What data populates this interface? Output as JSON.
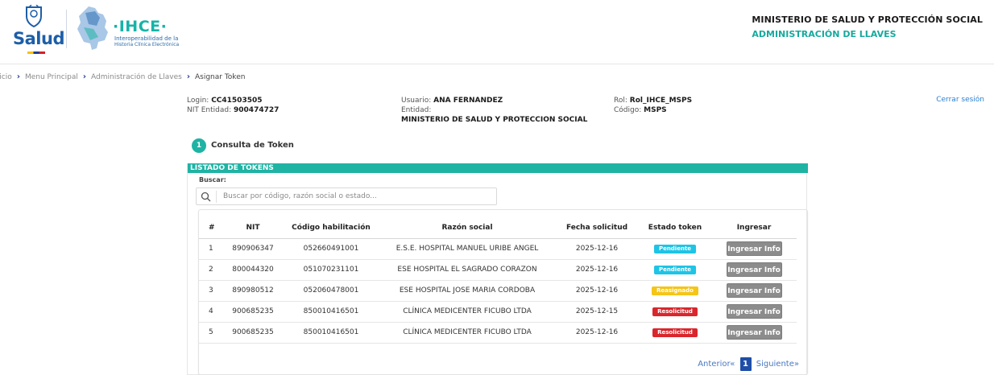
{
  "header": {
    "logo_salud": "Salud",
    "logo_ihce": "·IHCE·",
    "logo_ihce_sub1": "Interoperabilidad de la",
    "logo_ihce_sub2": "Historia Clínica Electrónica",
    "ministry_title": "MINISTERIO DE SALUD Y PROTECCIÓN SOCIAL",
    "ministry_subtitle": "ADMINISTRACIÓN DE LLAVES"
  },
  "breadcrumb": [
    "Inicio",
    "Menu Principal",
    "Administración de Llaves",
    "Asignar Token"
  ],
  "user_info": {
    "login_label": "Login:",
    "login_value": "CC41503505",
    "nit_label": "NIT Entidad:",
    "nit_value": "900474727",
    "usuario_label": "Usuario:",
    "usuario_value": "ANA FERNANDEZ",
    "entidad_label": "Entidad:",
    "entidad_value": "MINISTERIO DE SALUD Y PROTECCION SOCIAL",
    "rol_label": "Rol:",
    "rol_value": "Rol_IHCE_MSPS",
    "codigo_label": "Código:",
    "codigo_value": "MSPS",
    "logout": "Cerrar sesión"
  },
  "step": {
    "number": "1",
    "label": "Consulta de Token"
  },
  "panel": {
    "title": "LISTADO DE TOKENS",
    "search_label": "Buscar:",
    "search_placeholder": "Buscar por código, razón social o estado..."
  },
  "table": {
    "columns": [
      "#",
      "NIT",
      "Código habilitación",
      "Razón social",
      "Fecha solicitud",
      "Estado token",
      "Ingresar"
    ],
    "rows": [
      {
        "n": "1",
        "nit": "890906347",
        "codigo": "052660491001",
        "razon": "E.S.E. HOSPITAL MANUEL URIBE ANGEL",
        "fecha": "2025-12-16",
        "estado": "Pendiente",
        "action": "Ingresar Info"
      },
      {
        "n": "2",
        "nit": "800044320",
        "codigo": "051070231101",
        "razon": "ESE HOSPITAL EL SAGRADO CORAZON",
        "fecha": "2025-12-16",
        "estado": "Pendiente",
        "action": "Ingresar Info"
      },
      {
        "n": "3",
        "nit": "890980512",
        "codigo": "052060478001",
        "razon": "ESE HOSPITAL JOSE MARIA CORDOBA",
        "fecha": "2025-12-16",
        "estado": "Reasignado",
        "action": "Ingresar Info"
      },
      {
        "n": "4",
        "nit": "900685235",
        "codigo": "850010416501",
        "razon": "CLÍNICA MEDICENTER FICUBO LTDA",
        "fecha": "2025-12-15",
        "estado": "Resolicitud",
        "action": "Ingresar Info"
      },
      {
        "n": "5",
        "nit": "900685235",
        "codigo": "850010416501",
        "razon": "CLÍNICA MEDICENTER FICUBO LTDA",
        "fecha": "2025-12-16",
        "estado": "Resolicitud",
        "action": "Ingresar Info"
      }
    ]
  },
  "status_colors": {
    "Pendiente": "#1ec4e6",
    "Reasignado": "#f5c518",
    "Resolicitud": "#d9262c"
  },
  "pager": {
    "prev": "Anterior«",
    "current": "1",
    "next": "Siguiente»"
  }
}
